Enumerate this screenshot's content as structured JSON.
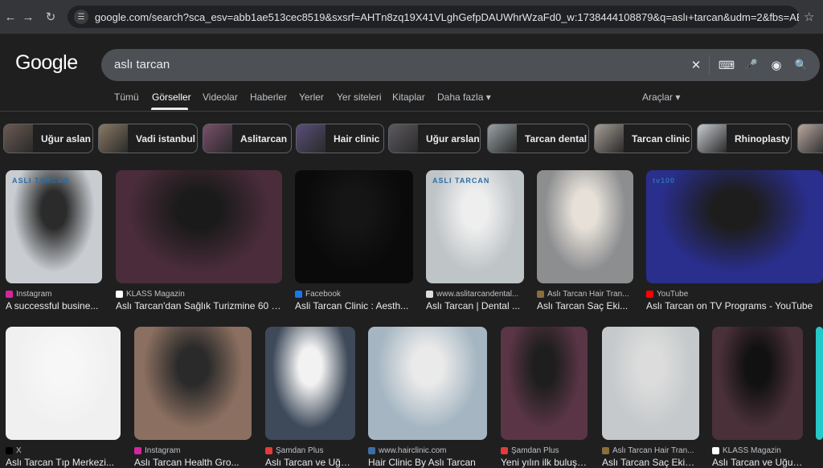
{
  "browser": {
    "url": "google.com/search?sca_esv=abb1ae513cec8519&sxsrf=AHTn8zq19X41VLghGefpDAUWhrWzaFd0_w:1738444108879&q=aslı+tarcan&udm=2&fbs=ABzOT_B1WPL43Bhj34oxlfGSUtl...",
    "back_icon": "←",
    "forward_icon": "→",
    "reload_icon": "↻",
    "site_info_icon": "☰",
    "star_icon": "☆"
  },
  "google": {
    "logo": "Google",
    "query": "aslı tarcan",
    "icons": {
      "clear": "✕",
      "keyboard": "⌨",
      "mic": "🎤",
      "lens": "◉",
      "search": "🔍"
    }
  },
  "tabs": [
    {
      "label": "Tümü"
    },
    {
      "label": "Görseller"
    },
    {
      "label": "Videolar"
    },
    {
      "label": "Haberler"
    },
    {
      "label": "Yerler"
    },
    {
      "label": "Yer siteleri"
    },
    {
      "label": "Kitaplar"
    },
    {
      "label": "Daha fazla ▾"
    },
    {
      "label": "Araçlar ▾"
    }
  ],
  "chips": [
    {
      "label": "Uğur aslan",
      "color": "#6b5a52"
    },
    {
      "label": "Vadi istanbul",
      "color": "#8a7a63"
    },
    {
      "label": "Aslitarcan",
      "color": "#7a4f6b"
    },
    {
      "label": "Hair clinic",
      "color": "#5a4e7a"
    },
    {
      "label": "Uğur arslan",
      "color": "#5e5a60"
    },
    {
      "label": "Tarcan dental",
      "color": "#9aa3a6"
    },
    {
      "label": "Tarcan clinic",
      "color": "#a69e95"
    },
    {
      "label": "Rhinoplasty",
      "color": "#c8ccd1"
    },
    {
      "label": "",
      "color": "#b9a8a0"
    }
  ],
  "row1": [
    {
      "source": "Instagram",
      "title": "A successful busine...",
      "fav": "#d6249f",
      "bg": "#c9cdd2",
      "fg": "#2b2b2b",
      "logo_text": "ASLI TARCAN"
    },
    {
      "source": "KLASS Magazin",
      "title": "Aslı Tarcan'dan Sağlık Turizmine 60 M...",
      "fav": "#ffffff",
      "bg": "#4a2c3a",
      "fg": "#1a1a1a",
      "logo_text": ""
    },
    {
      "source": "Facebook",
      "title": "Asli Tarcan Clinic : Aesth...",
      "fav": "#1877f2",
      "bg": "#0a0a0a",
      "fg": "#151515",
      "logo_text": ""
    },
    {
      "source": "www.aslitarcandental...",
      "title": "Aslı Tarcan | Dental ...",
      "fav": "#dddddd",
      "bg": "#bfc4c7",
      "fg": "#eeeeee",
      "logo_text": "ASLI TARCAN"
    },
    {
      "source": "Aslı Tarcan Hair Tran...",
      "title": "Aslı Tarcan Saç Eki...",
      "fav": "#8a6d3b",
      "bg": "#8c8e90",
      "fg": "#e6e0d8",
      "logo_text": ""
    },
    {
      "source": "YouTube",
      "title": "Aslı Tarcan on TV Programs - YouTube",
      "fav": "#ff0000",
      "bg": "#2a2e8c",
      "fg": "#1d1d1d",
      "logo_text": "tv100"
    }
  ],
  "row2": [
    {
      "source": "X",
      "title": "Aslı Tarcan Tıp Merkezi...",
      "fav": "#000000",
      "bg": "#f0f0f0",
      "fg": "#f7f7f7"
    },
    {
      "source": "Instagram",
      "title": "Aslı Tarcan Health Gro...",
      "fav": "#d6249f",
      "bg": "#8b6f60",
      "fg": "#2a2a2a"
    },
    {
      "source": "Şamdan Plus",
      "title": "Aslı Tarcan ve Uğur A...",
      "fav": "#e23b3b",
      "bg": "#3e4a5a",
      "fg": "#f2f2f2"
    },
    {
      "source": "www.hairclinic.com",
      "title": "Hair Clinic By Aslı Tarcan",
      "fav": "#3a6ea5",
      "bg": "#a5b6c2",
      "fg": "#eaeaea"
    },
    {
      "source": "Şamdan Plus",
      "title": "Yeni yılın ilk buluşması",
      "fav": "#e23b3b",
      "bg": "#5a3545",
      "fg": "#1e1e1e"
    },
    {
      "source": "Aslı Tarcan Hair Tran...",
      "title": "Aslı Tarcan Saç Ekimi...",
      "fav": "#8a6d3b",
      "bg": "#c5c9cb",
      "fg": "#dcdcdc"
    },
    {
      "source": "KLASS Magazin",
      "title": "Aslı Tarcan ve Uğur ...",
      "fav": "#ffffff",
      "bg": "#4a3038",
      "fg": "#111111"
    },
    {
      "source": "",
      "title": "",
      "fav": "#1f1f1f",
      "bg": "#25c7c7",
      "fg": "#25c7c7"
    }
  ]
}
